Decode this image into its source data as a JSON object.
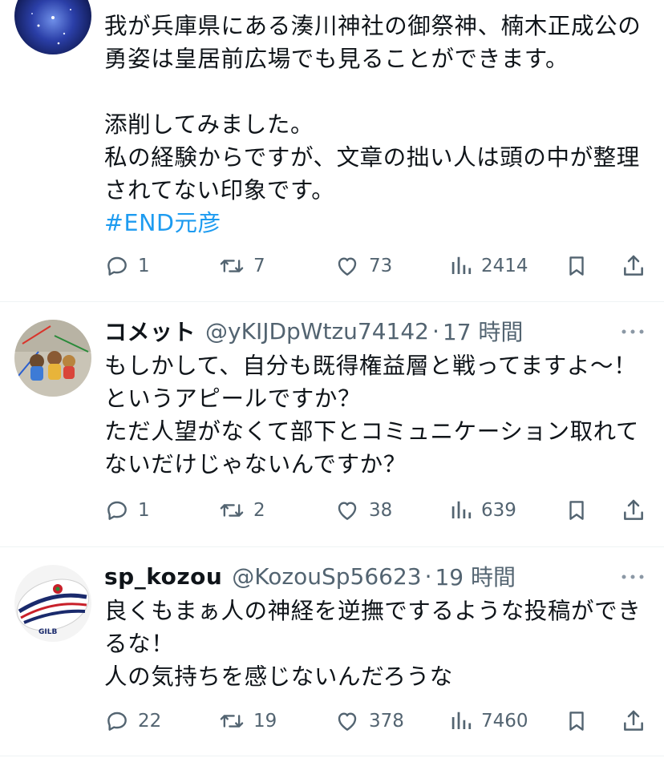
{
  "colors": {
    "text": "#0f1419",
    "secondary": "#536471",
    "link": "#1d9bf0",
    "divider": "#eff3f4"
  },
  "tweets": [
    {
      "body": [
        "我が兵庫県にある湊川神社の御祭神、楠木正成公の勇姿は皇居前広場でも見ることができます。",
        "",
        "添削してみました。",
        "私の経験からですが、文章の拙い人は頭の中が整理されてない印象です。"
      ],
      "hashtag": "#END元彦",
      "avatar_icon": "galaxy-avatar",
      "actions": {
        "replies": "1",
        "retweets": "7",
        "likes": "73",
        "views": "2414"
      }
    },
    {
      "display_name": "コメット",
      "handle": "@yKIJDpWtzu74142",
      "separator": "·",
      "time": "17 時間",
      "body": [
        "もしかして、自分も既得権益層と戦ってますよ～！というアピールですか？",
        "ただ人望がなくて部下とコミュニケーション取れてないだけじゃないんですか？"
      ],
      "avatar_icon": "figurines-avatar",
      "actions": {
        "replies": "1",
        "retweets": "2",
        "likes": "38",
        "views": "639"
      }
    },
    {
      "display_name": "sp_kozou",
      "handle": "@KozouSp56623",
      "separator": "·",
      "time": "19 時間",
      "body": [
        "良くもまぁ人の神経を逆撫でするような投稿ができるな！",
        "人の気持ちを感じないんだろうな"
      ],
      "avatar_icon": "rugby-ball-avatar",
      "actions": {
        "replies": "22",
        "retweets": "19",
        "likes": "378",
        "views": "7460"
      }
    }
  ]
}
